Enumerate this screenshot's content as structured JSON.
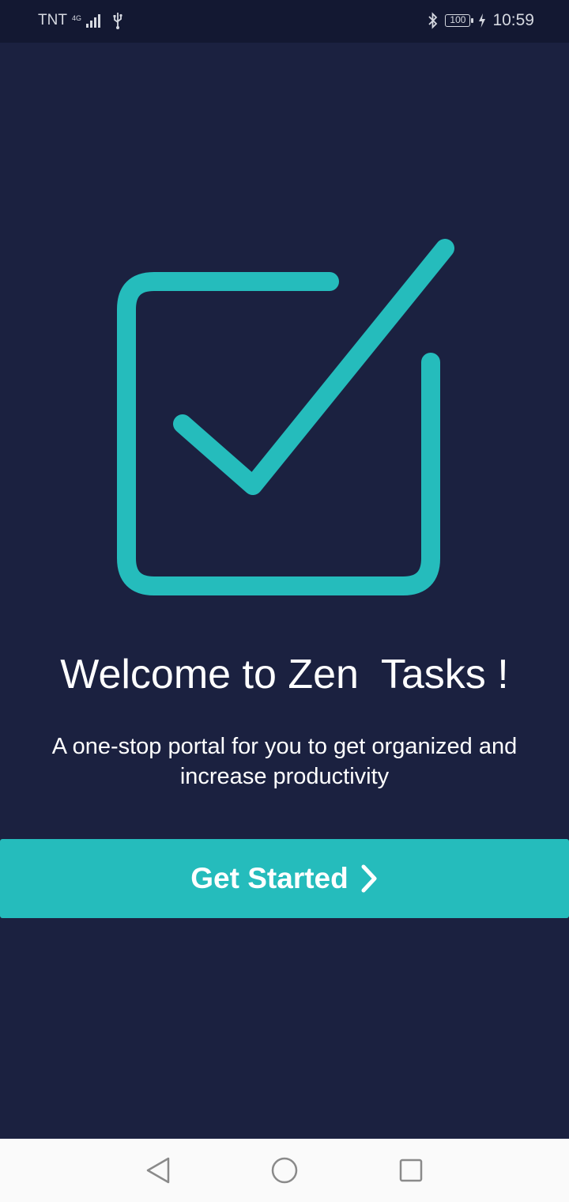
{
  "status_bar": {
    "carrier": "TNT",
    "network_type": "4G",
    "battery_level": "100",
    "time": "10:59",
    "icons": [
      "signal-icon",
      "usb-icon",
      "bluetooth-icon",
      "battery-icon",
      "charging-icon"
    ]
  },
  "colors": {
    "background": "#1b2140",
    "status_bar": "#131832",
    "accent": "#25bcbc",
    "nav_bar": "#fafafa"
  },
  "welcome": {
    "title": "Welcome to Zen  Tasks !",
    "subtitle": "A one-stop portal for you to get organized and increase productivity"
  },
  "actions": {
    "get_started_label": "Get Started",
    "get_started_icon": "chevron-right-icon"
  },
  "nav_bar": {
    "buttons": [
      "back-icon",
      "home-icon",
      "recents-icon"
    ]
  }
}
